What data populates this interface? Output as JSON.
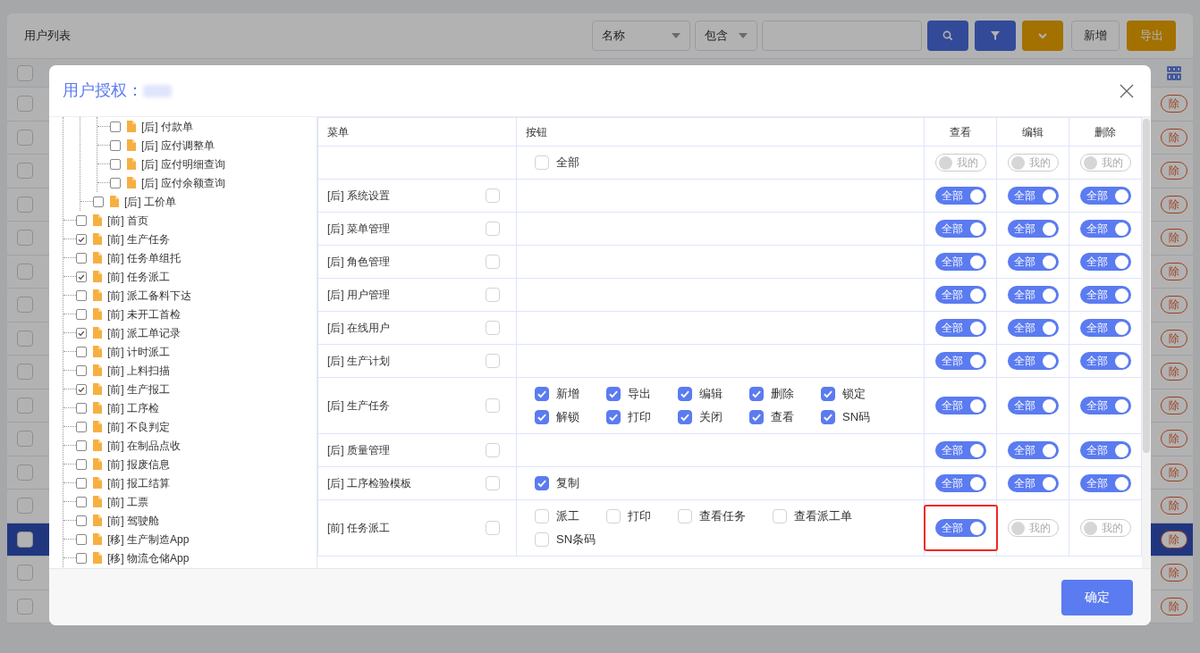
{
  "background": {
    "title": "用户列表",
    "filters": [
      {
        "label": "名称"
      },
      {
        "label": "包含"
      }
    ],
    "buttons": [
      {
        "kind": "search"
      },
      {
        "kind": "filter"
      },
      {
        "kind": "expand"
      },
      {
        "kind": "plain",
        "label": "新增"
      },
      {
        "kind": "warning",
        "label": "导出"
      }
    ],
    "select_all": {
      "checked": false
    },
    "rows": [
      {
        "selected": false,
        "checked": false,
        "action": "除"
      },
      {
        "selected": false,
        "checked": false,
        "action": "除"
      },
      {
        "selected": false,
        "checked": false,
        "action": "除"
      },
      {
        "selected": false,
        "checked": false,
        "action": "除"
      },
      {
        "selected": false,
        "checked": false,
        "action": "除"
      },
      {
        "selected": false,
        "checked": false,
        "action": "除"
      },
      {
        "selected": false,
        "checked": false,
        "action": "除"
      },
      {
        "selected": false,
        "checked": false,
        "action": "除"
      },
      {
        "selected": false,
        "checked": false,
        "action": "除"
      },
      {
        "selected": false,
        "checked": false,
        "action": "除"
      },
      {
        "selected": false,
        "checked": false,
        "action": "除"
      },
      {
        "selected": false,
        "checked": false,
        "action": "除"
      },
      {
        "selected": false,
        "checked": false,
        "action": "除"
      },
      {
        "selected": true,
        "checked": false,
        "action": "除"
      },
      {
        "selected": false,
        "checked": false,
        "action": "除"
      },
      {
        "selected": false,
        "checked": false,
        "action": "除"
      }
    ]
  },
  "modal": {
    "title": "用户授权：",
    "tree": [
      {
        "children": [
          {
            "children": [
              {
                "label": "[后] 付款单",
                "checked": false
              },
              {
                "label": "[后] 应付调整单",
                "checked": false
              },
              {
                "label": "[后] 应付明细查询",
                "checked": false
              },
              {
                "label": "[后] 应付余额查询",
                "checked": false
              }
            ]
          },
          {
            "label": "[后] 工价单",
            "checked": false
          }
        ]
      },
      {
        "label": "[前] 首页",
        "checked": false
      },
      {
        "label": "[前] 生产任务",
        "checked": true
      },
      {
        "label": "[前] 任务单组托",
        "checked": false
      },
      {
        "label": "[前] 任务派工",
        "checked": true
      },
      {
        "label": "[前] 派工备料下达",
        "checked": false
      },
      {
        "label": "[前] 未开工首检",
        "checked": false
      },
      {
        "label": "[前] 派工单记录",
        "checked": true
      },
      {
        "label": "[前] 计时派工",
        "checked": false
      },
      {
        "label": "[前] 上料扫描",
        "checked": false
      },
      {
        "label": "[前] 生产报工",
        "checked": true
      },
      {
        "label": "[前] 工序检",
        "checked": false
      },
      {
        "label": "[前] 不良判定",
        "checked": false
      },
      {
        "label": "[前] 在制品点收",
        "checked": false
      },
      {
        "label": "[前] 报废信息",
        "checked": false
      },
      {
        "label": "[前] 报工结算",
        "checked": false
      },
      {
        "label": "[前] 工票",
        "checked": false
      },
      {
        "label": "[前] 驾驶舱",
        "checked": false
      },
      {
        "label": "[移] 生产制造App",
        "checked": false
      },
      {
        "label": "[移] 物流仓储App",
        "checked": false
      }
    ],
    "table": {
      "columns": [
        "菜单",
        "按钮",
        "查看",
        "编辑",
        "删除"
      ],
      "rows": [
        {
          "buttons": [
            {
              "label": "全部",
              "checked": false
            }
          ],
          "perms": [
            {
              "on": false,
              "label": "我的",
              "highlighted": false
            },
            {
              "on": false,
              "label": "我的",
              "highlighted": false
            },
            {
              "on": false,
              "label": "我的",
              "highlighted": false
            }
          ]
        },
        {
          "menu": "[后] 系统设置",
          "menu_checked": false,
          "buttons": [],
          "perms": [
            {
              "on": true,
              "label": "全部",
              "highlighted": false
            },
            {
              "on": true,
              "label": "全部",
              "highlighted": false
            },
            {
              "on": true,
              "label": "全部",
              "highlighted": false
            }
          ]
        },
        {
          "menu": "[后] 菜单管理",
          "menu_checked": false,
          "buttons": [],
          "perms": [
            {
              "on": true,
              "label": "全部",
              "highlighted": false
            },
            {
              "on": true,
              "label": "全部",
              "highlighted": false
            },
            {
              "on": true,
              "label": "全部",
              "highlighted": false
            }
          ]
        },
        {
          "menu": "[后] 角色管理",
          "menu_checked": false,
          "buttons": [],
          "perms": [
            {
              "on": true,
              "label": "全部",
              "highlighted": false
            },
            {
              "on": true,
              "label": "全部",
              "highlighted": false
            },
            {
              "on": true,
              "label": "全部",
              "highlighted": false
            }
          ]
        },
        {
          "menu": "[后] 用户管理",
          "menu_checked": false,
          "buttons": [],
          "perms": [
            {
              "on": true,
              "label": "全部",
              "highlighted": false
            },
            {
              "on": true,
              "label": "全部",
              "highlighted": false
            },
            {
              "on": true,
              "label": "全部",
              "highlighted": false
            }
          ]
        },
        {
          "menu": "[后] 在线用户",
          "menu_checked": false,
          "buttons": [],
          "perms": [
            {
              "on": true,
              "label": "全部",
              "highlighted": false
            },
            {
              "on": true,
              "label": "全部",
              "highlighted": false
            },
            {
              "on": true,
              "label": "全部",
              "highlighted": false
            }
          ]
        },
        {
          "menu": "[后] 生产计划",
          "menu_checked": false,
          "buttons": [],
          "perms": [
            {
              "on": true,
              "label": "全部",
              "highlighted": false
            },
            {
              "on": true,
              "label": "全部",
              "highlighted": false
            },
            {
              "on": true,
              "label": "全部",
              "highlighted": false
            }
          ]
        },
        {
          "menu": "[后] 生产任务",
          "menu_checked": false,
          "buttons": [
            {
              "label": "新增",
              "checked": true
            },
            {
              "label": "导出",
              "checked": true
            },
            {
              "label": "编辑",
              "checked": true
            },
            {
              "label": "删除",
              "checked": true
            },
            {
              "label": "锁定",
              "checked": true
            },
            {
              "label": "解锁",
              "checked": true
            },
            {
              "label": "打印",
              "checked": true
            },
            {
              "label": "关闭",
              "checked": true
            },
            {
              "label": "查看",
              "checked": true
            },
            {
              "label": "SN码",
              "checked": true
            }
          ],
          "perms": [
            {
              "on": true,
              "label": "全部",
              "highlighted": false
            },
            {
              "on": true,
              "label": "全部",
              "highlighted": false
            },
            {
              "on": true,
              "label": "全部",
              "highlighted": false
            }
          ]
        },
        {
          "menu": "[后] 质量管理",
          "menu_checked": false,
          "buttons": [],
          "perms": [
            {
              "on": true,
              "label": "全部",
              "highlighted": false
            },
            {
              "on": true,
              "label": "全部",
              "highlighted": false
            },
            {
              "on": true,
              "label": "全部",
              "highlighted": false
            }
          ]
        },
        {
          "menu": "[后] 工序检验模板",
          "menu_checked": false,
          "buttons": [
            {
              "label": "复制",
              "checked": true
            }
          ],
          "perms": [
            {
              "on": true,
              "label": "全部",
              "highlighted": false
            },
            {
              "on": true,
              "label": "全部",
              "highlighted": false
            },
            {
              "on": true,
              "label": "全部",
              "highlighted": false
            }
          ]
        },
        {
          "menu": "[前] 任务派工",
          "menu_checked": false,
          "buttons": [
            {
              "label": "派工",
              "checked": false
            },
            {
              "label": "打印",
              "checked": false
            },
            {
              "label": "查看任务",
              "checked": false
            },
            {
              "label": "查看派工单",
              "checked": false
            },
            {
              "label": "SN条码",
              "checked": false
            }
          ],
          "perms": [
            {
              "on": true,
              "label": "全部",
              "highlighted": true
            },
            {
              "on": false,
              "label": "我的",
              "highlighted": false
            },
            {
              "on": false,
              "label": "我的",
              "highlighted": false
            }
          ]
        }
      ]
    },
    "confirm": "确定"
  }
}
